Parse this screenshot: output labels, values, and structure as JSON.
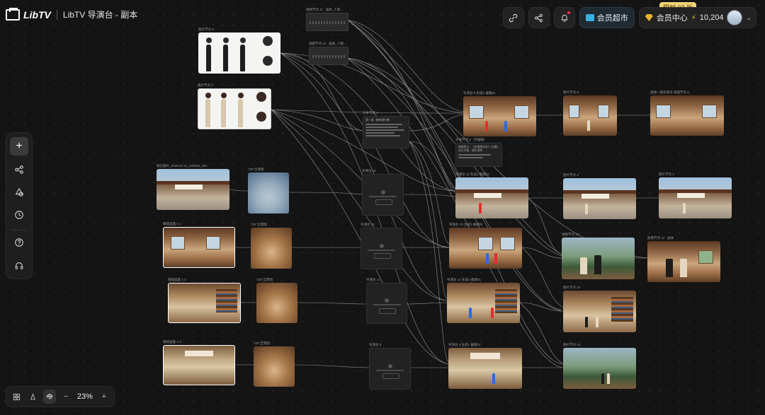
{
  "app": {
    "logo_text": "LibTV",
    "project_title": "LibTV 导演台 - 副本"
  },
  "header": {
    "vip_market_label": "会员超市",
    "member_center_label": "会员中心",
    "credits": "10,204",
    "promo_badge": "限时 37 折"
  },
  "icons": {
    "link": "link-icon",
    "share": "share-icon",
    "bell": "bell-icon",
    "market": "store-icon",
    "member": "diamond-icon",
    "credits": "bolt-icon",
    "avatar": "avatar",
    "add": "plus-icon",
    "workflow": "workflow-icon",
    "assets": "shapes-icon",
    "history": "clock-icon",
    "help": "help-icon",
    "support": "headset-icon"
  },
  "zoom": {
    "level": "23%",
    "minus": "−",
    "plus": "+"
  },
  "nodes": {
    "ref_a_label": "图片节点 6",
    "ref_b_label": "图片节点 2",
    "ext_label": "微信图片_2026-01-21_230055_433",
    "pano1_label": "720°全景图",
    "interior1_label": "咖啡画面 1-1",
    "pano2_label": "720°全景图",
    "interior2_label": "咖啡画面 1-3",
    "pano3_label": "720°全景图",
    "interior3_label": "咖啡画面 1-2",
    "pano4_label": "720°全景图",
    "text1_label": "文本节点 4",
    "text2_label": "文本节点 3（可编辑）",
    "gen1_label": "导演台 12",
    "gen2_label": "导演台 10",
    "gen3_label": "导演台 14",
    "gen4_label": "导演台 5",
    "video1_label": "视频节点 11 · 副本_人物…",
    "video2_label": "视频节点 12 · 副本_人物…",
    "out_r1_a": "导演台 9 生成1·截图01",
    "out_r1_b": "图片节点 8",
    "out_r1_c": "视频一镜多景导·视图节点 8",
    "out_r2_a": "导演台 12 生成1·截图01",
    "out_r2_b": "图片节点 4",
    "out_r2_c": "图片节点 3",
    "out_r3_a": "导演台 10 生成1·截图01",
    "out_r3_b": "视频节点 12",
    "out_r3_c": "图像节点 12 · 副本",
    "out_r4_a": "导演台 14 生成1·截图01",
    "out_r4_b": "图片节点 15",
    "out_r5_a": "导演台 5 生成1·截图01",
    "out_r5_b": "图片节点 13"
  },
  "text_content": {
    "t1_title": "第一场 · 咖啡馆外景",
    "t2_body": "根据提示：《金满周年庆》(分镜)设计方案，镜头说明"
  }
}
